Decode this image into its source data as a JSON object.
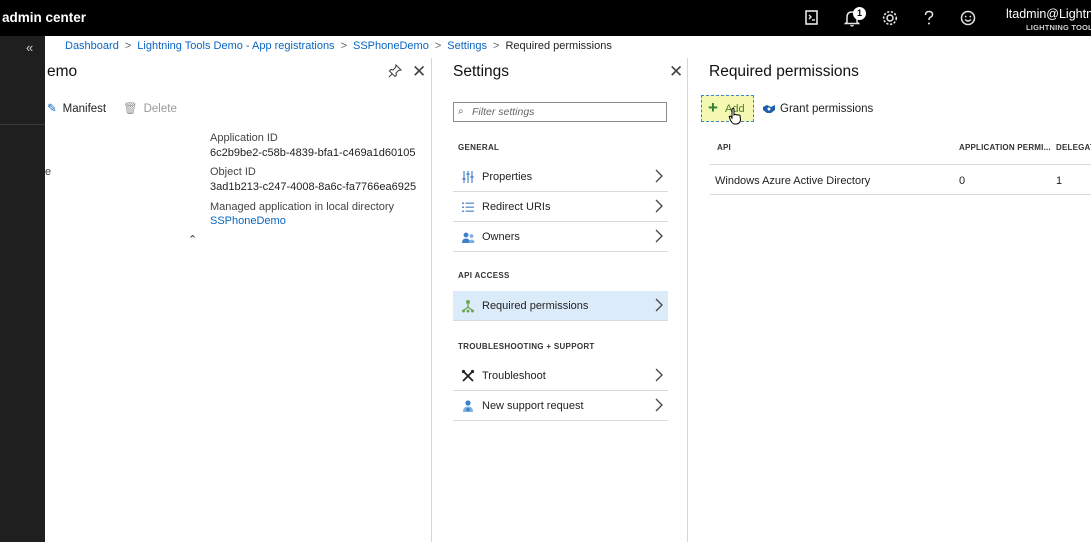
{
  "app": {
    "title": "admin center"
  },
  "topbar": {
    "notification_count": "1",
    "user_name": "ltadmin@Lightni",
    "user_org": "LIGHTNING TOOL",
    "icons": [
      "cloud-shell-icon",
      "bell-icon",
      "gear-icon",
      "help-icon",
      "smiley-icon"
    ]
  },
  "leftnav": {
    "collapse_label": "«"
  },
  "breadcrumb": [
    {
      "label": "Dashboard"
    },
    {
      "label": "Lightning Tools Demo - App registrations"
    },
    {
      "label": "SSPhoneDemo"
    },
    {
      "label": "Settings"
    },
    {
      "label": "Required permissions"
    }
  ],
  "app_blade": {
    "title": "emo",
    "toolbar": {
      "manifest_label": "Manifest",
      "delete_label": "Delete"
    },
    "stray_char": "e",
    "essentials": {
      "app_id_label": "Application ID",
      "app_id_value": "6c2b9be2-c58b-4839-bfa1-c469a1d60105",
      "object_id_label": "Object ID",
      "object_id_value": "3ad1b213-c247-4008-8a6c-fa7766ea6925",
      "managed_label": "Managed application in local directory",
      "managed_link": "SSPhoneDemo"
    }
  },
  "settings_blade": {
    "title": "Settings",
    "filter_placeholder": "Filter settings",
    "general_heading": "GENERAL",
    "general_items": [
      {
        "label": "Properties",
        "icon": "properties-icon"
      },
      {
        "label": "Redirect URIs",
        "icon": "list-icon"
      },
      {
        "label": "Owners",
        "icon": "owners-icon"
      }
    ],
    "api_heading": "API ACCESS",
    "api_items": [
      {
        "label": "Required permissions",
        "icon": "permissions-icon",
        "selected": true
      }
    ],
    "troubleshooting_heading": "TROUBLESHOOTING + SUPPORT",
    "troubleshooting_items": [
      {
        "label": "Troubleshoot",
        "icon": "tools-icon"
      },
      {
        "label": "New support request",
        "icon": "support-icon"
      }
    ]
  },
  "required_permissions_blade": {
    "title": "Required permissions",
    "toolbar": {
      "add_label": "Add",
      "grant_label": "Grant permissions"
    },
    "table": {
      "columns": [
        "API",
        "APPLICATION PERMI...",
        "DELEGAT"
      ],
      "rows": [
        [
          "Windows Azure Active Directory",
          "0",
          "1"
        ]
      ]
    }
  },
  "colors": {
    "topbar_bg": "#000000",
    "leftnav_bg": "#1f1f1f",
    "link": "#0a66c2",
    "selected_item_bg": "#dcebfa",
    "add_highlight": "#f4f8b0"
  }
}
